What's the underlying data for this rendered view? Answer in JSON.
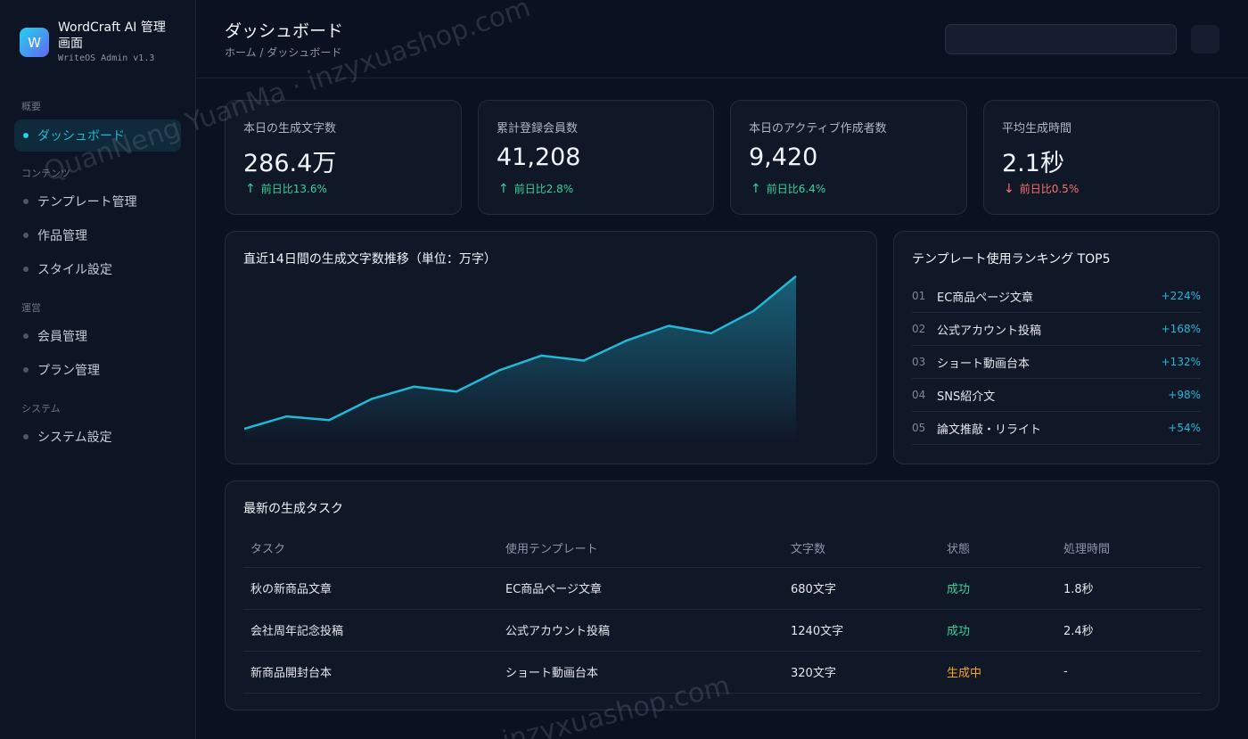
{
  "app": {
    "logo_letter": "W",
    "title": "WordCraft AI 管理画面",
    "subtitle": "WriteOS Admin v1.3"
  },
  "sidebar": {
    "sections": [
      {
        "label": "概要",
        "items": [
          {
            "label": "ダッシュボード",
            "active": true
          }
        ]
      },
      {
        "label": "コンテンツ",
        "items": [
          {
            "label": "テンプレート管理"
          },
          {
            "label": "作品管理"
          },
          {
            "label": "スタイル設定"
          }
        ]
      },
      {
        "label": "運営",
        "items": [
          {
            "label": "会員管理"
          },
          {
            "label": "プラン管理"
          }
        ]
      },
      {
        "label": "システム",
        "items": [
          {
            "label": "システム設定"
          }
        ]
      }
    ]
  },
  "header": {
    "title": "ダッシュボード",
    "breadcrumb": "ホーム / ダッシュボード"
  },
  "stats": [
    {
      "label": "本日の生成文字数",
      "value": "286.4万",
      "change": "前日比13.6%",
      "direction": "up"
    },
    {
      "label": "累計登録会員数",
      "value": "41,208",
      "change": "前日比2.8%",
      "direction": "up"
    },
    {
      "label": "本日のアクティブ作成者数",
      "value": "9,420",
      "change": "前日比6.4%",
      "direction": "up"
    },
    {
      "label": "平均生成時間",
      "value": "2.1秒",
      "change": "前日比0.5%",
      "direction": "down"
    }
  ],
  "icons": {
    "up": "↑",
    "down": "↓"
  },
  "colors": {
    "accent": "#22b8d8",
    "up": "#34d399",
    "down": "#f87171",
    "in_progress": "#f5a524"
  },
  "trend": {
    "title": "直近14日間の生成文字数推移（単位：万字）"
  },
  "chart_data": {
    "type": "area",
    "x": [
      1,
      2,
      3,
      4,
      5,
      6,
      7,
      8,
      9,
      10,
      11,
      12,
      13,
      14
    ],
    "values": [
      150,
      160,
      157,
      174,
      184,
      180,
      197,
      209,
      205,
      221,
      233,
      227,
      245,
      273
    ],
    "ylim": [
      140,
      280
    ],
    "grid": false,
    "color": "#22b8d8"
  },
  "ranking": {
    "title": "テンプレート使用ランキング TOP5",
    "items": [
      {
        "no": "01",
        "name": "EC商品ページ文章",
        "delta": "+224%"
      },
      {
        "no": "02",
        "name": "公式アカウント投稿",
        "delta": "+168%"
      },
      {
        "no": "03",
        "name": "ショート動画台本",
        "delta": "+132%"
      },
      {
        "no": "04",
        "name": "SNS紹介文",
        "delta": "+98%"
      },
      {
        "no": "05",
        "name": "論文推敲・リライト",
        "delta": "+54%"
      }
    ]
  },
  "tasks": {
    "title": "最新の生成タスク",
    "columns": [
      "タスク",
      "使用テンプレート",
      "文字数",
      "状態",
      "処理時間"
    ],
    "rows": [
      {
        "task": "秋の新商品文章",
        "template": "EC商品ページ文章",
        "chars": "680文字",
        "status": "成功",
        "status_kind": "success",
        "time": "1.8秒"
      },
      {
        "task": "会社周年記念投稿",
        "template": "公式アカウント投稿",
        "chars": "1240文字",
        "status": "成功",
        "status_kind": "success",
        "time": "2.4秒"
      },
      {
        "task": "新商品開封台本",
        "template": "ショート動画台本",
        "chars": "320文字",
        "status": "生成中",
        "status_kind": "progress",
        "time": "-"
      }
    ]
  },
  "watermarks": [
    "QuanNeng YuanMa · inzyxuashop.com",
    "inzyxuashop.com"
  ]
}
